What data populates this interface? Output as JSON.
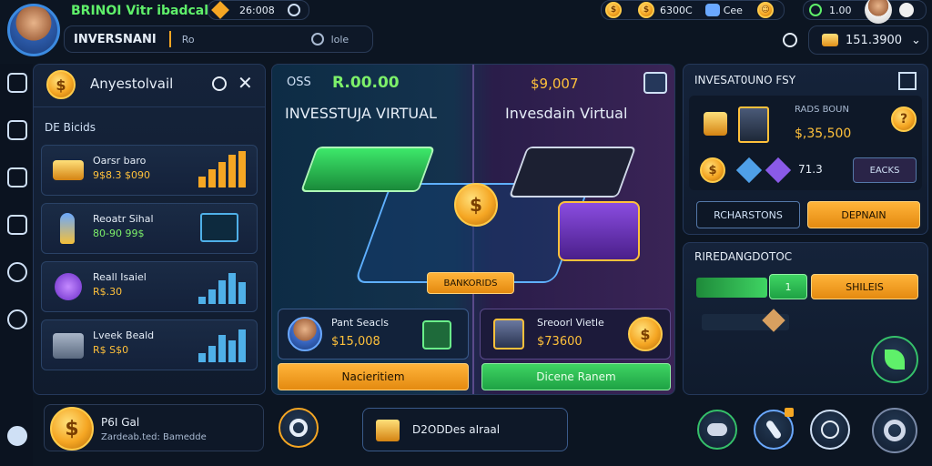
{
  "header": {
    "game_title": "BRINOI Vitr ibadcal",
    "player_name": "INVERSNANI",
    "tab_label": "Ro",
    "search_placeholder": "lole",
    "stat_1": "26:008",
    "coins_top": "6300C",
    "friend_label": "Cee",
    "balance": "151.3900",
    "topright_pill": "1.00"
  },
  "left_panel": {
    "title": "Anyestolvail",
    "section": "DE Bicids",
    "items": [
      {
        "name": "Oarsr baro",
        "value": "9$8.3 $090",
        "bars": [
          12,
          20,
          28,
          36,
          40
        ]
      },
      {
        "name": "Reoatr Sihal",
        "value": "80-90 99$",
        "bars": []
      },
      {
        "name": "Reall Isaiel",
        "value": "R$.30",
        "bars": [
          8,
          16,
          26,
          34,
          24
        ]
      },
      {
        "name": "Lveek Beald",
        "value": "R$ S$0",
        "bars": [
          10,
          18,
          30,
          24,
          36
        ]
      }
    ]
  },
  "center_panel": {
    "left_value_prefix": "OSS",
    "left_value": "R.00.00",
    "left_title": "INVESSTUJA VIRTUAL",
    "right_value": "$9,007",
    "right_title": "Invesdain Virtual",
    "center_badge": "BANKORIDS",
    "card_left": {
      "name": "Pant Seacls",
      "value": "$15,008",
      "button": "Nacieritiem"
    },
    "card_right": {
      "name": "Sreoorl Vietle",
      "value": "$73600",
      "button": "Dicene Ranem"
    }
  },
  "right_panel": {
    "top_title": "INVESAT0UNO FSY",
    "top_sub": "RADS BOUN",
    "top_value": "$,35,500",
    "small_value": "71.3",
    "small_btn": "EACKS",
    "btn_left": "RCHARSTONS",
    "btn_right": "DEPNAIN",
    "bottom_title": "RIREDANGDOTOC",
    "progress_value": "1",
    "progress_btn": "SHILEIS"
  },
  "bottom_bar": {
    "coin_title": "P6I Gal",
    "coin_sub": "Zardeab.ted: Bamedde",
    "chest_label": "D2ODDes aIraal"
  },
  "colors": {
    "accent_green": "#35c06a",
    "accent_orange": "#f5a623",
    "background": "#0c1522",
    "panel": "#15233a"
  }
}
